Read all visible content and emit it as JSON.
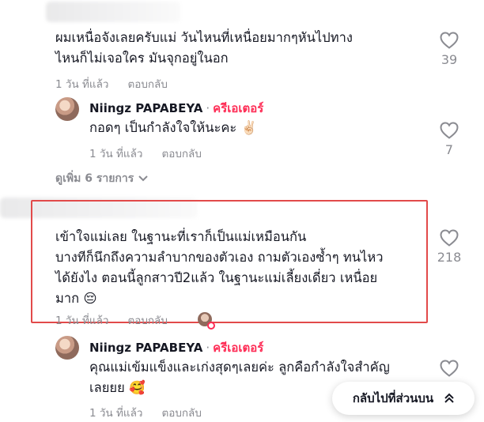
{
  "comments": [
    {
      "text_line1": "ผมเหนื่อจังเลยครับแม่ วันไหนที่เหนื่อยมากๆหันไปทาง",
      "text_line2": "ไหนก็ไม่เจอใคร มันจุกอยู่ในอก",
      "time": "1 วัน ที่แล้ว",
      "reply": "ตอบกลับ",
      "likes": "39"
    },
    {
      "author": "Niingz PAPABEYA",
      "sep": "·",
      "badge": "ครีเอเตอร์",
      "text": "กอดๆ เป็นกำลังใจให้นะคะ",
      "emoji": "✌🏻",
      "time": "1 วัน ที่แล้ว",
      "reply": "ตอบกลับ",
      "likes": "7"
    },
    {
      "text_line1": "เข้าใจแม่เลย ในฐานะที่เราก็เป็นแม่เหมือนกัน",
      "text_line2": "บางทีก็นึกถึงความลำบากของตัวเอง ถามตัวเองซ้ำๆ ทนไหว",
      "text_line3": "ได้ยังไง ตอนนี้ลูกสาวปี2แล้ว ในฐานะแม่เลี้ยงเดี่ยว เหนื่อย",
      "text_line4": "มาก",
      "emoji": "😔",
      "time": "1 วัน ที่แล้ว",
      "reply": "ตอบกลับ",
      "likes": "218"
    },
    {
      "author": "Niingz PAPABEYA",
      "sep": "·",
      "badge": "ครีเอเตอร์",
      "text_line1": "คุณแม่เข้มแข็งและเก่งสุดๆเลยค่ะ ลูกคือกำลังใจสำคัญ",
      "text_line2": "เลยยย",
      "emoji": "🥰",
      "time": "1 วัน ที่แล้ว",
      "reply": "ตอบกลับ"
    }
  ],
  "view_more": "ดูเพิ่ม 6 รายการ",
  "back_to_top": "กลับไปที่ส่วนบน",
  "colors": {
    "creator": "#fe2c55",
    "highlight": "#e24a4a",
    "muted": "#8a8b91"
  }
}
